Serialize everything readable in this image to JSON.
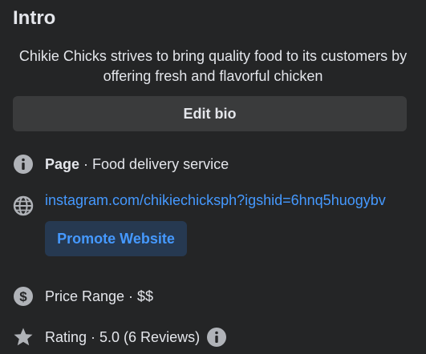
{
  "intro": {
    "title": "Intro",
    "bio": "Chikie Chicks strives to bring quality food to its customers by offering fresh and flavorful chicken",
    "edit_bio_label": "Edit bio"
  },
  "details": {
    "category": {
      "icon": "info-icon",
      "label": "Page",
      "value": " · Food delivery service"
    },
    "website": {
      "icon": "globe-icon",
      "url": "instagram.com/chikiechicksph?igshid=6hnq5huogybv",
      "promote_label": "Promote Website"
    },
    "price": {
      "icon": "dollar-icon",
      "text": "Price Range · $$"
    },
    "rating": {
      "icon": "star-icon",
      "text": "Rating · 5.0 (6 Reviews)",
      "info_icon": "info-icon"
    }
  },
  "colors": {
    "background": "#242526",
    "button": "#3a3b3c",
    "link": "#4599ff",
    "promote_bg": "#263951",
    "icon": "#b0b3b8"
  }
}
